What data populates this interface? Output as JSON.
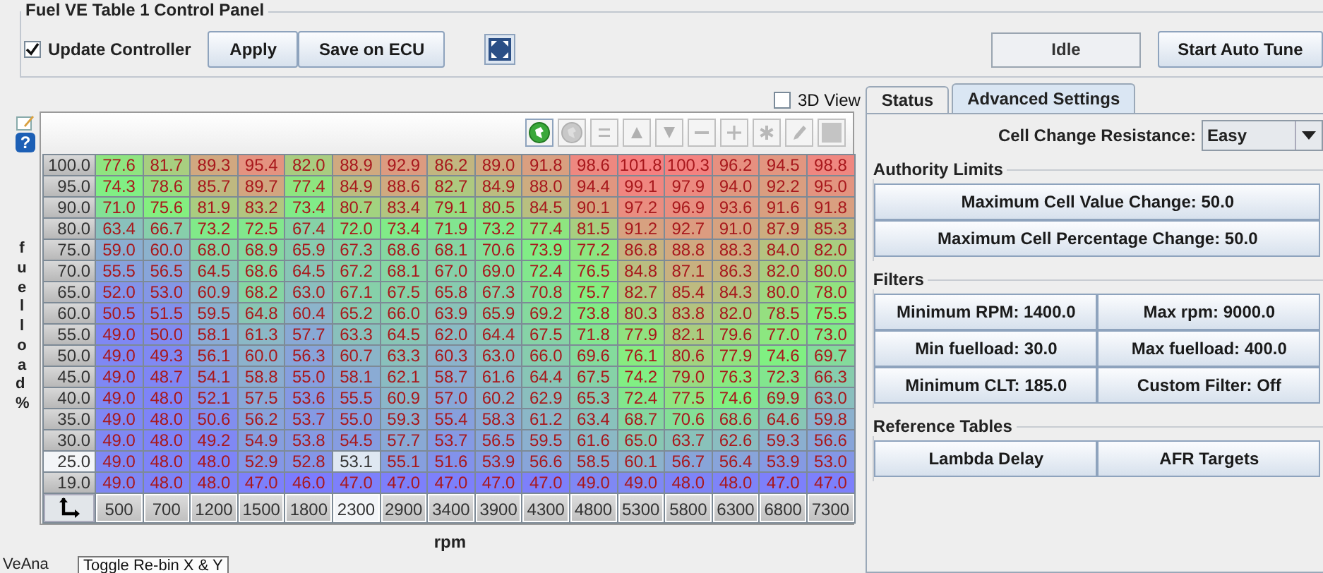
{
  "panel": {
    "title": "Fuel VE Table 1 Control Panel"
  },
  "controls": {
    "update_controller": {
      "label": "Update Controller",
      "checked": true
    },
    "buttons": [
      "Apply",
      "Save on ECU"
    ],
    "status": "Idle",
    "auto_tune_button": "Start Auto Tune"
  },
  "view_3d": {
    "label": "3D View",
    "checked": false
  },
  "tabs": [
    {
      "label": "Status",
      "selected": false
    },
    {
      "label": "Advanced Settings",
      "selected": true
    }
  ],
  "help_icon": "?",
  "toolbar": [
    {
      "kind": "sync",
      "disabled": false
    },
    {
      "kind": "sync",
      "disabled": true
    },
    {
      "kind": "equals",
      "disabled": true
    },
    {
      "kind": "up",
      "disabled": true
    },
    {
      "kind": "down",
      "disabled": true
    },
    {
      "kind": "minus",
      "disabled": true
    },
    {
      "kind": "plus",
      "disabled": true
    },
    {
      "kind": "star",
      "disabled": true
    },
    {
      "kind": "pencil",
      "disabled": true
    },
    {
      "kind": "square",
      "disabled": true
    }
  ],
  "table": {
    "y_label": "fuelload %",
    "rows": [
      {
        "label": "100.0",
        "selected": false,
        "cells": [
          "77.6",
          "81.7",
          "89.3",
          "95.4",
          "82.0",
          "88.9",
          "92.9",
          "86.2",
          "89.0",
          "91.8",
          "98.6",
          "101.8",
          "100.3",
          "96.2",
          "94.5",
          "98.8"
        ]
      },
      {
        "label": "95.0",
        "selected": false,
        "cells": [
          "74.3",
          "78.6",
          "85.7",
          "89.7",
          "77.4",
          "84.9",
          "88.6",
          "82.7",
          "84.9",
          "88.0",
          "94.4",
          "99.1",
          "97.9",
          "94.0",
          "92.2",
          "95.0"
        ]
      },
      {
        "label": "90.0",
        "selected": false,
        "cells": [
          "71.0",
          "75.6",
          "81.9",
          "83.2",
          "73.4",
          "80.7",
          "83.4",
          "79.1",
          "80.5",
          "84.5",
          "90.1",
          "97.2",
          "96.9",
          "93.6",
          "91.6",
          "91.8"
        ]
      },
      {
        "label": "80.0",
        "selected": false,
        "cells": [
          "63.4",
          "66.7",
          "73.2",
          "72.5",
          "67.4",
          "72.0",
          "73.4",
          "71.9",
          "73.2",
          "77.4",
          "81.5",
          "91.2",
          "92.7",
          "91.0",
          "87.9",
          "85.3"
        ]
      },
      {
        "label": "75.0",
        "selected": false,
        "cells": [
          "59.0",
          "60.0",
          "68.0",
          "68.9",
          "65.9",
          "67.3",
          "68.6",
          "68.1",
          "70.6",
          "73.9",
          "77.2",
          "86.8",
          "88.8",
          "88.3",
          "84.0",
          "82.0"
        ]
      },
      {
        "label": "70.0",
        "selected": false,
        "cells": [
          "55.5",
          "56.5",
          "64.5",
          "68.6",
          "64.5",
          "67.2",
          "68.1",
          "67.0",
          "69.0",
          "72.4",
          "76.5",
          "84.8",
          "87.1",
          "86.3",
          "82.0",
          "80.0"
        ]
      },
      {
        "label": "65.0",
        "selected": false,
        "cells": [
          "52.0",
          "53.0",
          "60.9",
          "68.2",
          "63.0",
          "67.1",
          "67.5",
          "65.8",
          "67.3",
          "70.8",
          "75.7",
          "82.7",
          "85.4",
          "84.3",
          "80.0",
          "78.0"
        ]
      },
      {
        "label": "60.0",
        "selected": false,
        "cells": [
          "50.5",
          "51.5",
          "59.5",
          "64.8",
          "60.4",
          "65.2",
          "66.0",
          "63.9",
          "65.9",
          "69.2",
          "73.8",
          "80.3",
          "83.8",
          "82.0",
          "78.5",
          "75.5"
        ]
      },
      {
        "label": "55.0",
        "selected": false,
        "cells": [
          "49.0",
          "50.0",
          "58.1",
          "61.3",
          "57.7",
          "63.3",
          "64.5",
          "62.0",
          "64.4",
          "67.5",
          "71.8",
          "77.9",
          "82.1",
          "79.6",
          "77.0",
          "73.0"
        ]
      },
      {
        "label": "50.0",
        "selected": false,
        "cells": [
          "49.0",
          "49.3",
          "56.1",
          "60.0",
          "56.3",
          "60.7",
          "63.3",
          "60.3",
          "63.0",
          "66.0",
          "69.6",
          "76.1",
          "80.6",
          "77.9",
          "74.6",
          "69.7"
        ]
      },
      {
        "label": "45.0",
        "selected": false,
        "cells": [
          "49.0",
          "48.7",
          "54.1",
          "58.8",
          "55.0",
          "58.1",
          "62.1",
          "58.7",
          "61.6",
          "64.4",
          "67.5",
          "74.2",
          "79.0",
          "76.3",
          "72.3",
          "66.3"
        ]
      },
      {
        "label": "40.0",
        "selected": false,
        "cells": [
          "49.0",
          "48.0",
          "52.1",
          "57.5",
          "53.6",
          "55.5",
          "60.9",
          "57.0",
          "60.2",
          "62.9",
          "65.3",
          "72.4",
          "77.5",
          "74.6",
          "69.9",
          "63.0"
        ]
      },
      {
        "label": "35.0",
        "selected": false,
        "cells": [
          "49.0",
          "48.0",
          "50.6",
          "56.2",
          "53.7",
          "55.0",
          "59.3",
          "55.4",
          "58.3",
          "61.2",
          "63.4",
          "68.7",
          "70.6",
          "68.6",
          "64.6",
          "59.8"
        ]
      },
      {
        "label": "30.0",
        "selected": false,
        "cells": [
          "49.0",
          "48.0",
          "49.2",
          "54.9",
          "53.8",
          "54.5",
          "57.7",
          "53.7",
          "56.5",
          "59.5",
          "61.6",
          "65.0",
          "63.7",
          "62.6",
          "59.3",
          "56.6"
        ]
      },
      {
        "label": "25.0",
        "selected": true,
        "cells": [
          "49.0",
          "48.0",
          "48.0",
          "52.9",
          "52.8",
          "53.1",
          "55.1",
          "51.6",
          "53.9",
          "56.6",
          "58.5",
          "60.1",
          "56.7",
          "56.4",
          "53.9",
          "53.0"
        ]
      },
      {
        "label": "19.0",
        "selected": false,
        "cells": [
          "49.0",
          "48.0",
          "48.0",
          "47.0",
          "46.0",
          "47.0",
          "47.0",
          "47.0",
          "47.0",
          "47.0",
          "49.0",
          "49.0",
          "48.0",
          "48.0",
          "47.0",
          "47.0"
        ]
      }
    ],
    "x_bins": [
      {
        "label": "500",
        "selected": false
      },
      {
        "label": "700",
        "selected": false
      },
      {
        "label": "1200",
        "selected": false
      },
      {
        "label": "1500",
        "selected": false
      },
      {
        "label": "1800",
        "selected": false
      },
      {
        "label": "2300",
        "selected": true
      },
      {
        "label": "2900",
        "selected": false
      },
      {
        "label": "3400",
        "selected": false
      },
      {
        "label": "3900",
        "selected": false
      },
      {
        "label": "4300",
        "selected": false
      },
      {
        "label": "4800",
        "selected": false
      },
      {
        "label": "5300",
        "selected": false
      },
      {
        "label": "5800",
        "selected": false
      },
      {
        "label": "6300",
        "selected": false
      },
      {
        "label": "6800",
        "selected": false
      },
      {
        "label": "7300",
        "selected": false
      }
    ],
    "x_label": "rpm"
  },
  "tooltip": "Toggle Re-bin X & Y",
  "bottom_tab": "VeAna",
  "settings": {
    "resistance_label": "Cell Change Resistance:",
    "resistance_value": "Easy",
    "groups": [
      {
        "title": "Authority Limits",
        "kind": "stack",
        "buttons": [
          "Maximum Cell Value Change: 50.0",
          "Maximum Cell Percentage Change: 50.0"
        ]
      },
      {
        "title": "Filters",
        "kind": "grid",
        "buttons": [
          "Minimum RPM: 1400.0",
          "Max rpm: 9000.0",
          "Min fuelload: 30.0",
          "Max fuelload: 400.0",
          "Minimum CLT: 185.0",
          "Custom Filter: Off"
        ]
      },
      {
        "title": "Reference Tables",
        "kind": "grid",
        "buttons": [
          "Lambda Delay",
          "AFR Targets"
        ]
      }
    ]
  }
}
